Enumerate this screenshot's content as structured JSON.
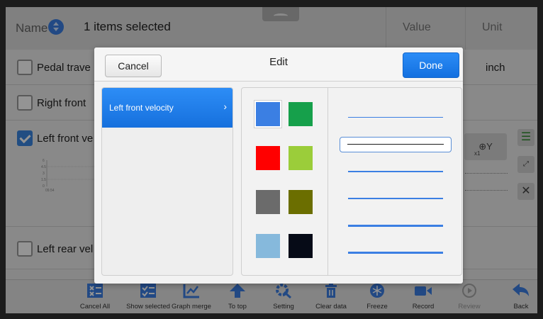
{
  "header": {
    "name_label": "Name",
    "selection_text": "1 items selected",
    "value_col": "Value",
    "unit_col": "Unit"
  },
  "rows": [
    {
      "label": "Pedal trave",
      "checked": false,
      "unit": "inch"
    },
    {
      "label": "Right front",
      "checked": false,
      "unit": ""
    },
    {
      "label": "Left front ve",
      "checked": true,
      "unit": ""
    },
    {
      "label": "Left rear vel",
      "checked": false,
      "unit": ""
    }
  ],
  "mini_graph": {
    "y_ticks": [
      "6",
      "4.5",
      "3",
      "1.5",
      "0"
    ],
    "x_tick": "09.54"
  },
  "zoom_button": {
    "label": "⊕Y",
    "sub": "x1"
  },
  "toolbar": [
    {
      "label": "Cancel All",
      "icon": "cancel-all-icon",
      "disabled": false
    },
    {
      "label": "Show selected",
      "icon": "show-selected-icon",
      "disabled": false
    },
    {
      "label": "Graph merge",
      "icon": "graph-merge-icon",
      "disabled": false
    },
    {
      "label": "To top",
      "icon": "to-top-icon",
      "disabled": false
    },
    {
      "label": "Setting",
      "icon": "setting-icon",
      "disabled": false
    },
    {
      "label": "Clear data",
      "icon": "clear-data-icon",
      "disabled": false
    },
    {
      "label": "Freeze",
      "icon": "freeze-icon",
      "disabled": false
    },
    {
      "label": "Record",
      "icon": "record-icon",
      "disabled": false
    },
    {
      "label": "Review",
      "icon": "review-icon",
      "disabled": true
    },
    {
      "label": "Back",
      "icon": "back-icon",
      "disabled": false
    }
  ],
  "modal": {
    "title": "Edit",
    "cancel_label": "Cancel",
    "done_label": "Done",
    "list_items": [
      {
        "label": "Left front velocity",
        "selected": true
      }
    ],
    "colors": [
      "#3b7fe3",
      "#16a04b",
      "#ff0000",
      "#9bcd3a",
      "#6b6b6b",
      "#6b6e00",
      "#86b9dc",
      "#060b17"
    ],
    "selected_color": "#3b7fe3",
    "line_styles": [
      "thin",
      "selected",
      "medium",
      "medium",
      "thick",
      "thick"
    ],
    "selected_line": 1
  },
  "colors": {
    "accent": "#1a7ae8",
    "checkbox": "#3a86e0"
  }
}
